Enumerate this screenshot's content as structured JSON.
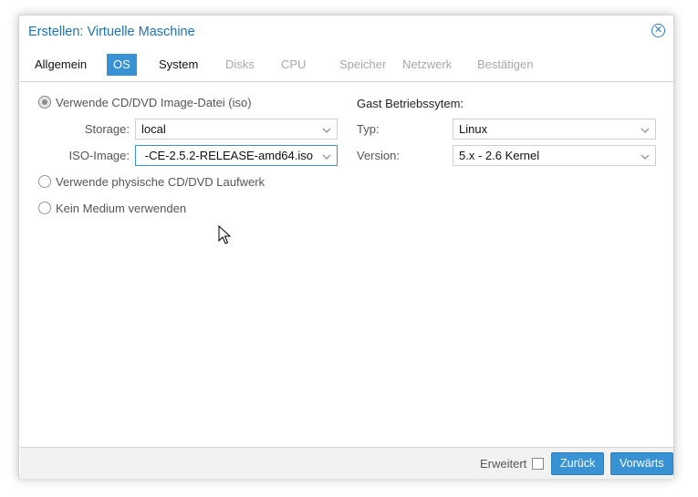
{
  "dialog": {
    "title": "Erstellen: Virtuelle Maschine",
    "close_icon": "close-circle-icon"
  },
  "tabs": [
    {
      "label": "Allgemein",
      "state": "normal"
    },
    {
      "label": "OS",
      "state": "active"
    },
    {
      "label": "System",
      "state": "normal"
    },
    {
      "label": "Disks",
      "state": "disabled"
    },
    {
      "label": "CPU",
      "state": "disabled"
    },
    {
      "label": "Speicher",
      "state": "disabled"
    },
    {
      "label": "Netzwerk",
      "state": "disabled"
    },
    {
      "label": "Bestätigen",
      "state": "disabled"
    }
  ],
  "media": {
    "option_iso": "Verwende CD/DVD Image-Datei (iso)",
    "option_iso_checked": true,
    "storage_label": "Storage:",
    "storage_value": "local",
    "iso_label": "ISO-Image:",
    "iso_value": "-CE-2.5.2-RELEASE-amd64.iso",
    "option_physical": "Verwende physische CD/DVD Laufwerk",
    "option_none": "Kein Medium verwenden"
  },
  "guest_os": {
    "section_title": "Gast Betriebssytem:",
    "type_label": "Typ:",
    "type_value": "Linux",
    "version_label": "Version:",
    "version_value": "5.x - 2.6 Kernel"
  },
  "footer": {
    "advanced_label": "Erweitert",
    "advanced_checked": false,
    "back_label": "Zurück",
    "next_label": "Vorwärts"
  },
  "colors": {
    "accent": "#3892d4",
    "title": "#1a73b8",
    "disabled_tab": "#a8a8a8"
  }
}
